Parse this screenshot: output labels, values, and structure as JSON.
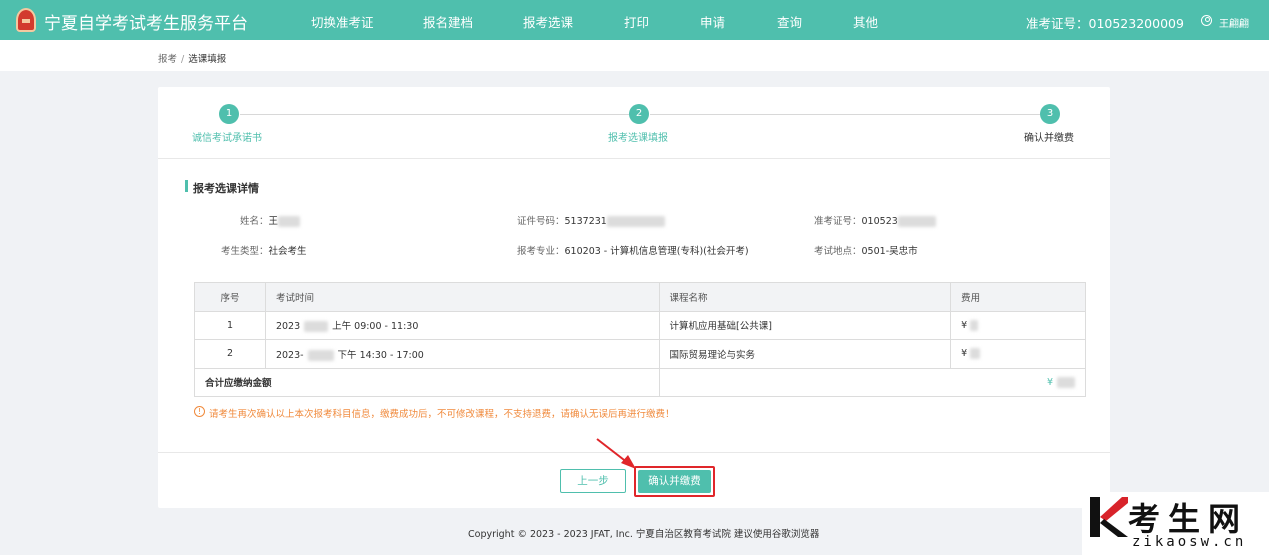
{
  "header": {
    "title": "宁夏自学考试考生服务平台",
    "nav": [
      "切换准考证",
      "报名建档",
      "报考选课",
      "打印",
      "申请",
      "查询",
      "其他"
    ],
    "ticket": "准考证号：010523200009",
    "user": "王翩翩",
    "brand_color": "#4fbfad"
  },
  "breadcrumb": {
    "parent": "报考",
    "separator": "/",
    "current": "选课填报"
  },
  "steps": [
    {
      "num": "1",
      "label": "诚信考试承诺书"
    },
    {
      "num": "2",
      "label": "报考选课填报"
    },
    {
      "num": "3",
      "label": "确认并缴费"
    }
  ],
  "section_title": "报考选课详情",
  "info": {
    "name_label": "姓名：",
    "name_value": "王",
    "id_label": "证件号码：",
    "id_value": "5137231",
    "ticket_label": "准考证号：",
    "ticket_value": "010523",
    "type_label": "考生类型：",
    "type_value": "社会考生",
    "major_label": "报考专业：",
    "major_value": "610203 - 计算机信息管理(专科)(社会开考)",
    "location_label": "考试地点：",
    "location_value": "0501-吴忠市"
  },
  "table": {
    "headers": [
      "序号",
      "考试时间",
      "课程名称",
      "费用"
    ],
    "rows": [
      {
        "no": "1",
        "time_prefix": "2023",
        "time_suffix": "上午 09:00 - 11:30",
        "course": "计算机应用基础[公共课]",
        "fee": "¥"
      },
      {
        "no": "2",
        "time_prefix": "2023-",
        "time_suffix": "下午 14:30 - 17:00",
        "course": "国际贸易理论与实务",
        "fee": "¥"
      }
    ],
    "total_label": "合计应缴纳金额",
    "total_value": "¥"
  },
  "warning": "请考生再次确认以上本次报考科目信息，缴费成功后，不可修改课程，不支持退费，请确认无误后再进行缴费！",
  "buttons": {
    "prev": "上一步",
    "confirm": "确认并缴费"
  },
  "footer": "Copyright © 2023 - 2023 JFAT, Inc. 宁夏自治区教育考试院 建议使用谷歌浏览器",
  "watermark": {
    "cn": "考生网",
    "url": "zikaosw.cn"
  }
}
